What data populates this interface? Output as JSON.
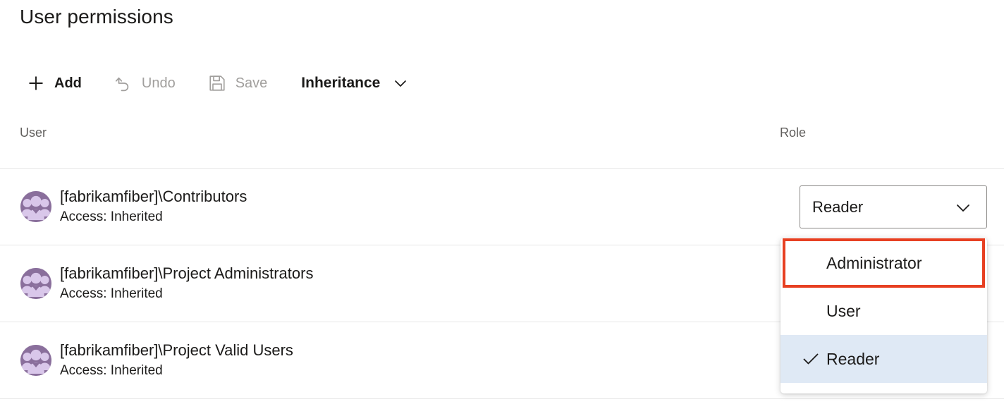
{
  "page": {
    "title": "User permissions"
  },
  "toolbar": {
    "add": {
      "label": "Add",
      "icon": "plus-icon",
      "disabled": false
    },
    "undo": {
      "label": "Undo",
      "icon": "undo-icon",
      "disabled": true
    },
    "save": {
      "label": "Save",
      "icon": "save-floppy-icon",
      "disabled": true
    },
    "inheritance": {
      "label": "Inheritance",
      "icon": "chevron-down-icon"
    }
  },
  "table": {
    "columns": {
      "user": "User",
      "role": "Role"
    },
    "rows": [
      {
        "name": "[fabrikamfiber]\\Contributors",
        "access": "Access: Inherited",
        "avatar": "group-avatar-icon",
        "role": "Reader"
      },
      {
        "name": "[fabrikamfiber]\\Project Administrators",
        "access": "Access: Inherited",
        "avatar": "group-avatar-icon",
        "role": ""
      },
      {
        "name": "[fabrikamfiber]\\Project Valid Users",
        "access": "Access: Inherited",
        "avatar": "group-avatar-icon",
        "role": ""
      }
    ]
  },
  "role_select": {
    "value": "Reader",
    "chevron": "chevron-down-icon",
    "expanded": true,
    "options": [
      {
        "label": "Administrator",
        "selected": false,
        "highlighted": true
      },
      {
        "label": "User",
        "selected": false,
        "highlighted": false
      },
      {
        "label": "Reader",
        "selected": true,
        "highlighted": false
      }
    ]
  },
  "colors": {
    "callout_red": "#e74022",
    "selected_row_blue": "#dfe9f5",
    "avatar_purple": "#8a6f9c",
    "avatar_glyph": "#d9c7ea",
    "disabled_gray": "#a19f9d",
    "header_gray": "#605e5c",
    "rule_gray": "#e6e6e6"
  }
}
